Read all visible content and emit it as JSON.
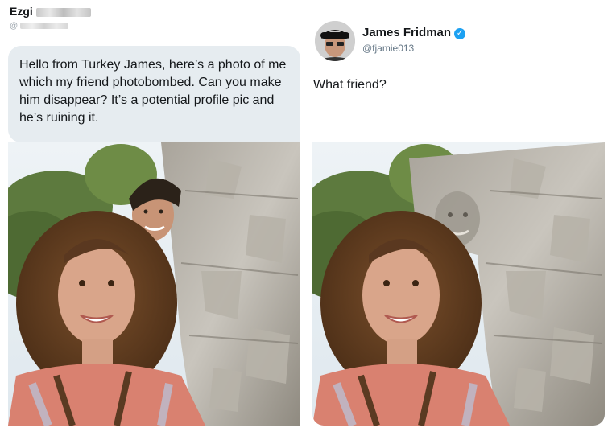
{
  "sender": {
    "name": "Ezgi",
    "handle_prefix": "@"
  },
  "request": {
    "text": "Hello from Turkey James, here’s a photo of me which my friend photobombed. Can you make him disappear? It’s a potential profile pic and he’s ruining it."
  },
  "reply": {
    "name": "James Fridman",
    "verified_glyph": "✓",
    "handle": "@fjamie013",
    "text": "What friend?"
  },
  "icons": {
    "verified": "verified-badge-icon"
  },
  "colors": {
    "bubble": "#e6ecf0",
    "verified": "#1da1f2",
    "handle": "#657786"
  }
}
